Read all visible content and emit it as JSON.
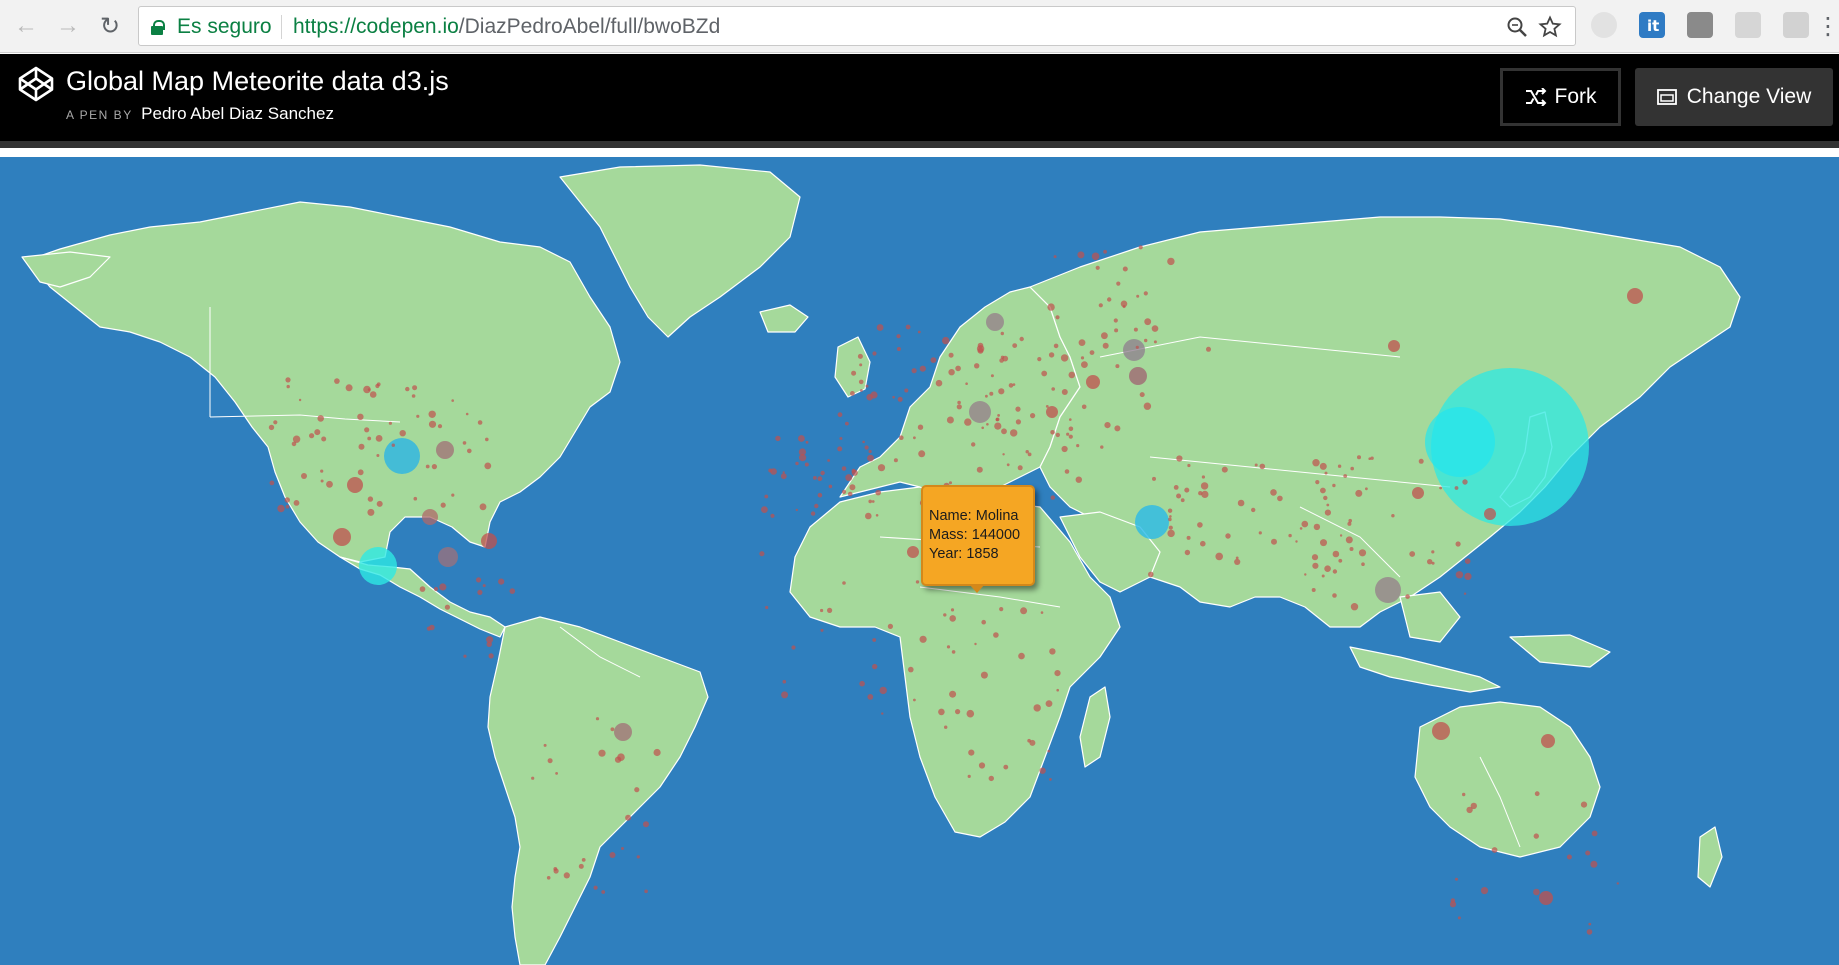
{
  "browser": {
    "secure_label": "Es seguro",
    "url_host": "https://codepen.io",
    "url_path": "/DiazPedroAbel/full/bwoBZd"
  },
  "header": {
    "title": "Global Map Meteorite data d3.js",
    "pen_by": "A PEN BY",
    "author": "Pedro Abel Diaz Sanchez",
    "fork_label": "Fork",
    "change_view_label": "Change View"
  },
  "colors": {
    "ocean": "#2f7fbe",
    "land": "#a5d99b",
    "border": "#ffffff",
    "meteorite": "#c0504d",
    "large_meteorite": "#2ee8e3",
    "tooltip": "#f5a623"
  },
  "tooltip": {
    "name_line": "Name: Molina",
    "mass_line": "Mass: 144000",
    "year_line": "Year: 1858"
  }
}
